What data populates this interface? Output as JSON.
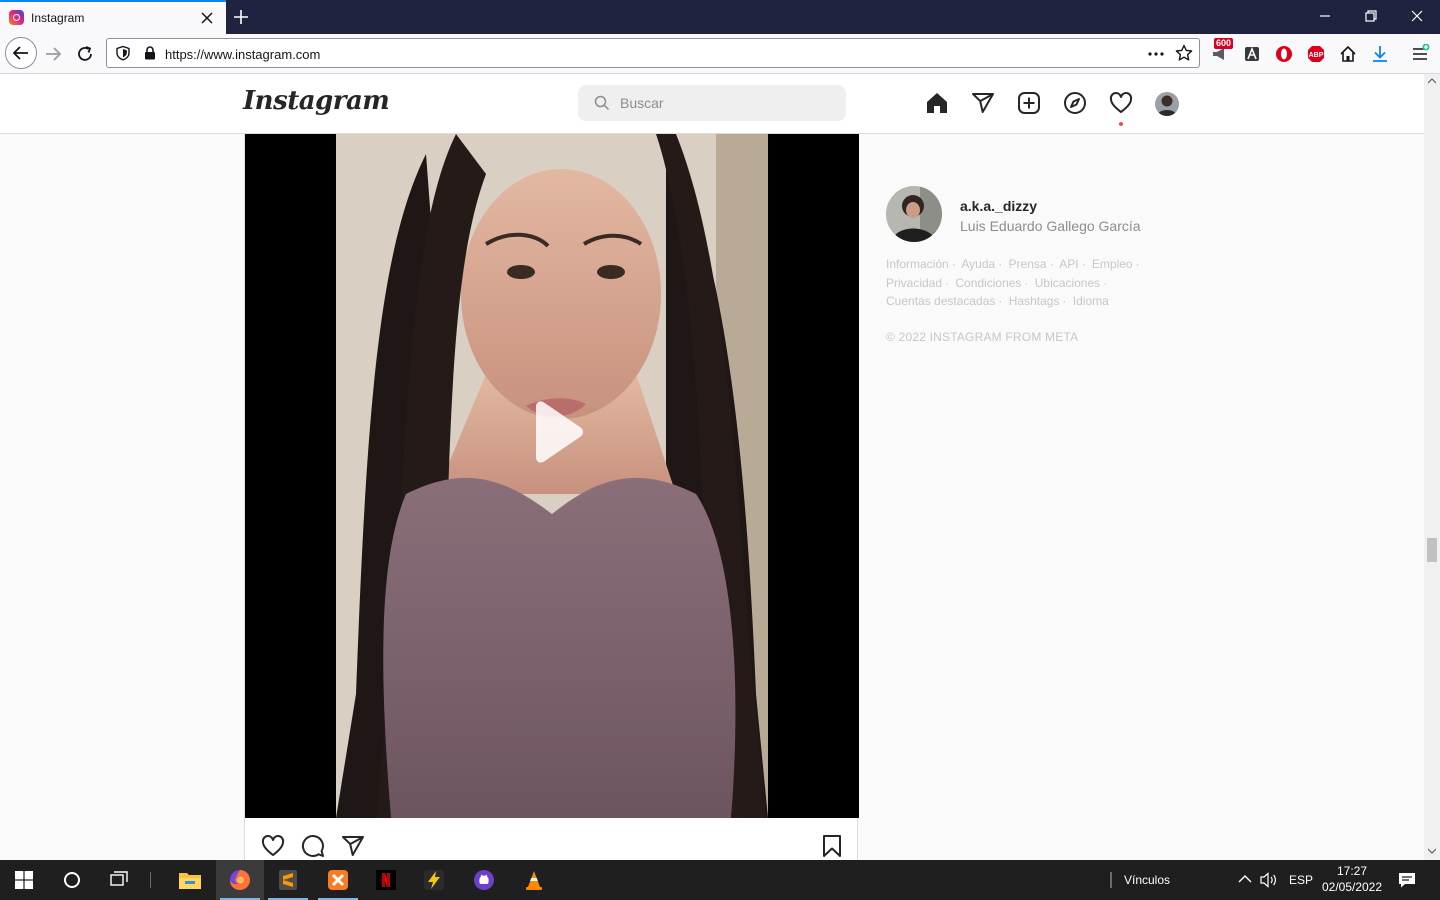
{
  "browser": {
    "tab_title": "Instagram",
    "url": "https://www.instagram.com",
    "badge_count": "600"
  },
  "instagram": {
    "logo": "Instagram",
    "search_placeholder": "Buscar"
  },
  "sidebar": {
    "username": "a.k.a._dizzy",
    "full_name": "Luis Eduardo Gallego García",
    "links": [
      "Información",
      "Ayuda",
      "Prensa",
      "API",
      "Empleo",
      "Privacidad",
      "Condiciones",
      "Ubicaciones",
      "Cuentas destacadas",
      "Hashtags",
      "Idioma"
    ],
    "copyright": "© 2022 INSTAGRAM FROM META"
  },
  "taskbar": {
    "links_label": "Vínculos",
    "language": "ESP",
    "time": "17:27",
    "date": "02/05/2022"
  },
  "colors": {
    "titlebar": "#202340",
    "accent": "#0a84ff",
    "notification": "#ed4956"
  }
}
